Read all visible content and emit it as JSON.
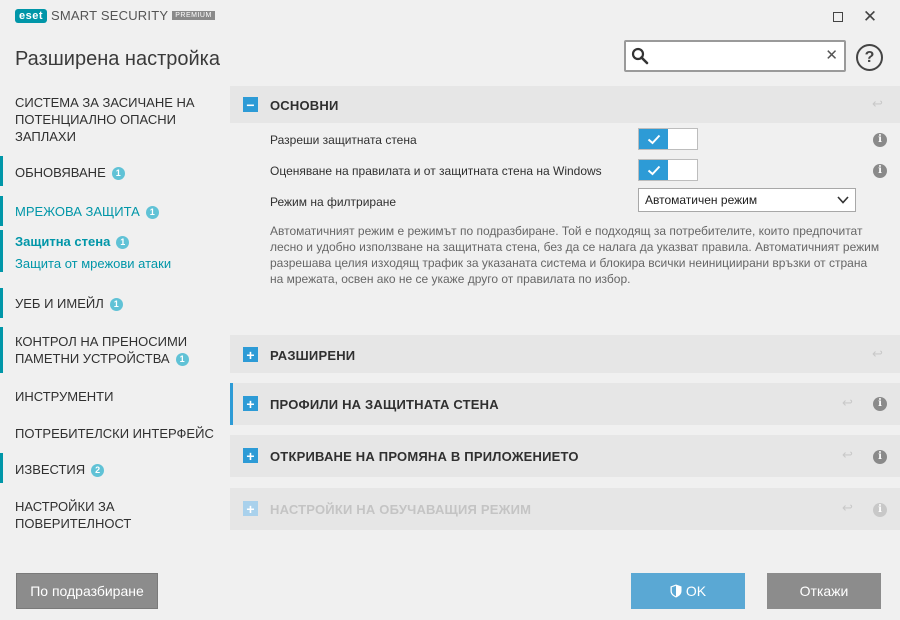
{
  "window": {
    "brand": "eset",
    "product": "SMART SECURITY",
    "edition": "PREMIUM"
  },
  "header": {
    "title": "Разширена настройка",
    "search_value": "",
    "help_label": "?"
  },
  "sidebar": {
    "items": [
      {
        "label": "СИСТЕМА ЗА ЗАСИЧАНЕ НА ПОТЕНЦИАЛНО ОПАСНИ ЗАПЛАХИ"
      },
      {
        "label": "ОБНОВЯВАНЕ",
        "badge": "1"
      },
      {
        "label": "МРЕЖОВА ЗАЩИТА",
        "badge": "1"
      },
      {
        "label": "Защитна стена",
        "badge": "1"
      },
      {
        "label": "Защита от мрежови атаки"
      },
      {
        "label": "УЕБ И ИМЕЙЛ",
        "badge": "1"
      },
      {
        "label": "КОНТРОЛ НА ПРЕНОСИМИ ПАМЕТНИ УСТРОЙСТВА",
        "badge": "1"
      },
      {
        "label": "ИНСТРУМЕНТИ"
      },
      {
        "label": "ПОТРЕБИТЕЛСКИ ИНТЕРФЕЙС"
      },
      {
        "label": "ИЗВЕСТИЯ",
        "badge": "2"
      },
      {
        "label": "НАСТРОЙКИ ЗА ПОВЕРИТЕЛНОСТ"
      }
    ]
  },
  "main": {
    "basic": {
      "title": "ОСНОВНИ",
      "toggle": "−",
      "rows": [
        {
          "label": "Разреши защитната стена",
          "enabled": true
        },
        {
          "label": "Оценяване на правилата и от защитната стена на Windows",
          "enabled": true
        }
      ],
      "filter_label": "Режим на филтриране",
      "filter_value": "Автоматичен режим",
      "description": "Автоматичният режим е режимът по подразбиране. Той е подходящ за потребителите, които предпочитат лесно и удобно използване на защитната стена, без да се налага да указват правила. Автоматичният режим разрешава целия изходящ трафик за указаната система и блокира всички неинициирани връзки от страна на мрежата, освен ако не се укаже друго от правилата по избор."
    },
    "sections": [
      {
        "title": "РАЗШИРЕНИ",
        "toggle": "+"
      },
      {
        "title": "ПРОФИЛИ НА ЗАЩИТНАТА СТЕНА",
        "toggle": "+"
      },
      {
        "title": "ОТКРИВАНЕ НА ПРОМЯНА В ПРИЛОЖЕНИЕТО",
        "toggle": "+"
      },
      {
        "title": "НАСТРОЙКИ НА ОБУЧАВАЩИЯ РЕЖИМ",
        "toggle": "+"
      }
    ],
    "info_glyph": "i"
  },
  "footer": {
    "default_label": "По подразбиране",
    "ok_label": "OK",
    "cancel_label": "Откажи"
  },
  "colors": {
    "accent": "#0096a8",
    "toggle_blue": "#2d9bd6",
    "badge": "#60c2d6",
    "ok_button": "#5aa8d4",
    "gray_button": "#8c8c8c"
  }
}
